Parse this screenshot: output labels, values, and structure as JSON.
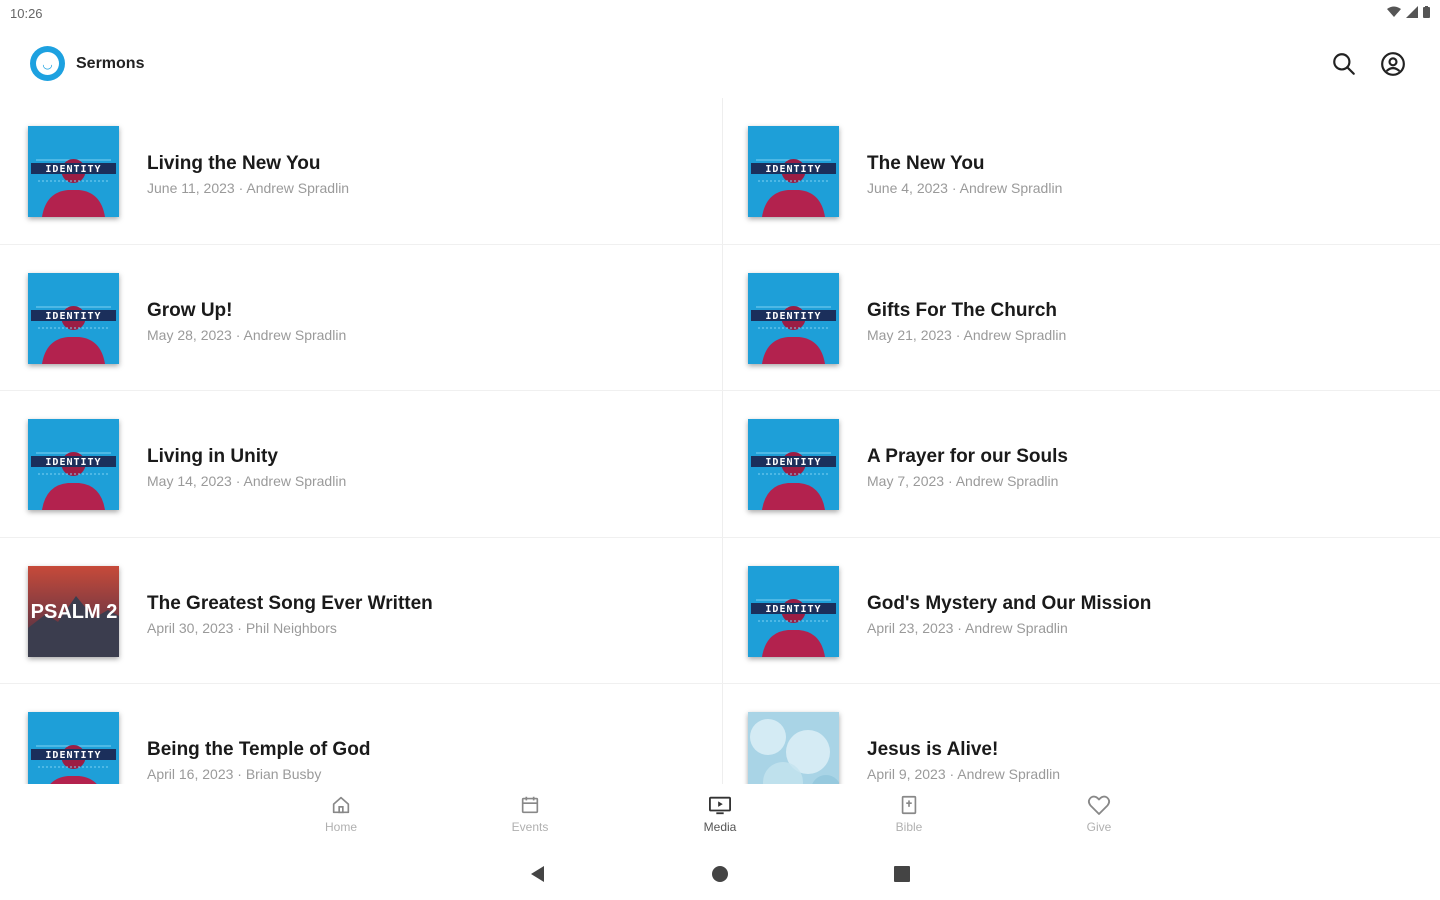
{
  "status": {
    "time": "10:26"
  },
  "app": {
    "title": "Sermons",
    "logo_glyph": "◡",
    "accent": "#1da1e0"
  },
  "actions": {
    "search": "search-icon",
    "account": "account-circle-icon"
  },
  "sermons": [
    {
      "title": "Living the New You",
      "meta": "June 11, 2023 · Andrew Spradlin",
      "art": "identity"
    },
    {
      "title": "The New You",
      "meta": "June 4, 2023 · Andrew Spradlin",
      "art": "identity"
    },
    {
      "title": "Grow Up!",
      "meta": "May 28, 2023 · Andrew Spradlin",
      "art": "identity"
    },
    {
      "title": "Gifts For The Church",
      "meta": "May 21, 2023 · Andrew Spradlin",
      "art": "identity"
    },
    {
      "title": "Living in Unity",
      "meta": "May 14, 2023 · Andrew Spradlin",
      "art": "identity"
    },
    {
      "title": "A Prayer for our Souls",
      "meta": "May 7, 2023 · Andrew Spradlin",
      "art": "identity"
    },
    {
      "title": "The Greatest Song Ever Written",
      "meta": "April 30, 2023 · Phil Neighbors",
      "art": "psalm",
      "art_text": "PSALM 2"
    },
    {
      "title": "God's Mystery and Our Mission",
      "meta": "April 23, 2023 · Andrew Spradlin",
      "art": "identity"
    },
    {
      "title": "Being the Temple of God",
      "meta": "April 16, 2023 · Brian Busby",
      "art": "identity"
    },
    {
      "title": "Jesus is Alive!",
      "meta": "April 9, 2023 · Andrew Spradlin",
      "art": "cloud"
    }
  ],
  "identity_art_text": "IDENTITY",
  "tabs": [
    {
      "label": "Home",
      "icon": "home-icon"
    },
    {
      "label": "Events",
      "icon": "calendar-icon"
    },
    {
      "label": "Media",
      "icon": "media-icon",
      "active": true
    },
    {
      "label": "Bible",
      "icon": "bible-icon"
    },
    {
      "label": "Give",
      "icon": "heart-icon"
    }
  ]
}
